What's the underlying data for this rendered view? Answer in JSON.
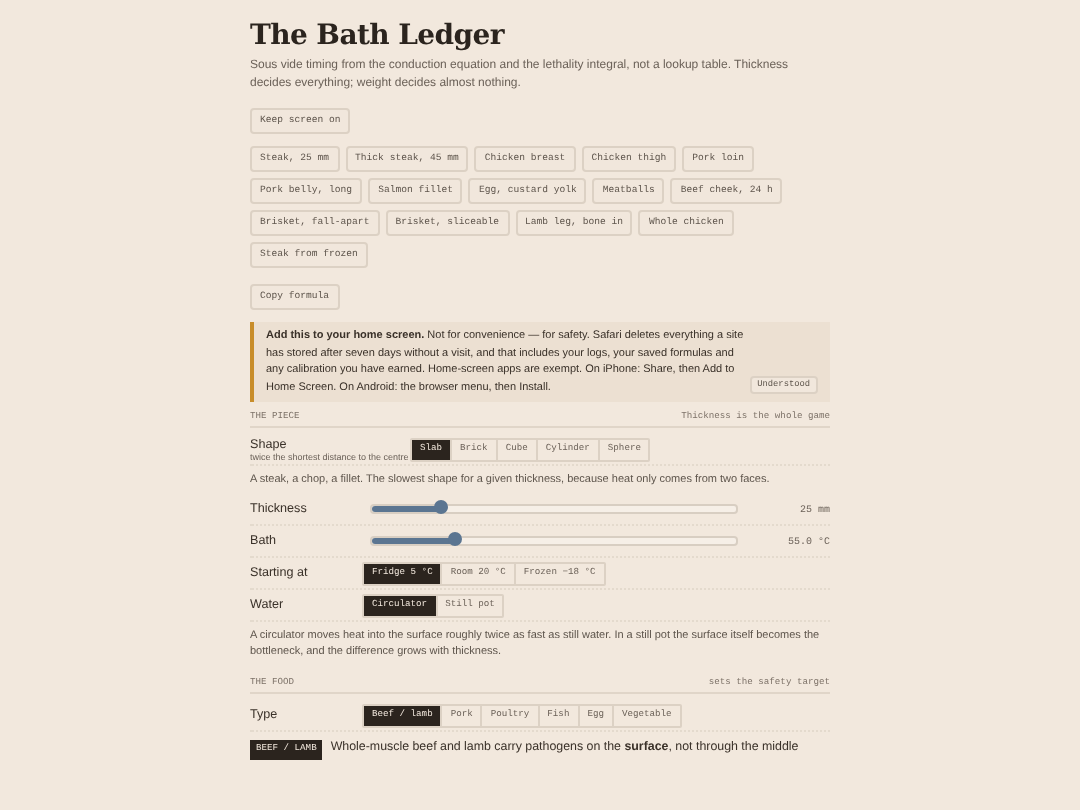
{
  "title": "The Bath Ledger",
  "subtitle": "Sous vide timing from the conduction equation and the lethality integral, not a lookup table. Thickness decides everything; weight decides almost nothing.",
  "keep_screen_button": "Keep screen on",
  "presets": [
    "Steak, 25 mm",
    "Thick steak, 45 mm",
    "Chicken breast",
    "Chicken thigh",
    "Pork loin",
    "Pork belly, long",
    "Salmon fillet",
    "Egg, custard yolk",
    "Meatballs",
    "Beef cheek, 24 h",
    "Brisket, fall-apart",
    "Brisket, sliceable",
    "Lamb leg, bone in",
    "Whole chicken",
    "Steak from frozen"
  ],
  "copy_button": "Copy formula",
  "notice": {
    "text": "**Add this to your home screen.** Not for convenience — for safety. Safari deletes everything a site has stored after seven days without a visit, and that includes your logs, your saved formulas and any calibration you have earned. Home-screen apps are exempt. On iPhone: Share, then Add to Home Screen. On Android: the browser menu, then Install.",
    "button": "Understood"
  },
  "sections": [
    {
      "heading": "THE PIECE",
      "note": "Thickness is the whole game",
      "rows": [
        {
          "kind": "segmented",
          "label": "Shape",
          "hint": "twice the shortest distance to the centre",
          "options": [
            {
              "label": "Slab",
              "selected": true
            },
            {
              "label": "Brick",
              "selected": false
            },
            {
              "label": "Cube",
              "selected": false
            },
            {
              "label": "Cylinder",
              "selected": false
            },
            {
              "label": "Sphere",
              "selected": false
            }
          ]
        },
        {
          "kind": "text",
          "text": "A steak, a chop, a fillet. The slowest shape for a given thickness, because heat only comes from two faces."
        },
        {
          "kind": "slider",
          "label": "Thickness",
          "level": 0.19,
          "reading": "25 mm"
        },
        {
          "kind": "slider",
          "label": "Bath",
          "level": 0.23,
          "reading": "55.0 °C"
        },
        {
          "kind": "segmented",
          "label": "Starting at",
          "options": [
            {
              "label": "Fridge 5 °C",
              "selected": true
            },
            {
              "label": "Room 20 °C",
              "selected": false
            },
            {
              "label": "Frozen −18 °C",
              "selected": false
            }
          ]
        },
        {
          "kind": "segmented",
          "label": "Water",
          "options": [
            {
              "label": "Circulator",
              "selected": true
            },
            {
              "label": "Still pot",
              "selected": false
            }
          ]
        },
        {
          "kind": "text",
          "text": "A circulator moves heat into the surface roughly twice as fast as still water. In a still pot the surface itself becomes the bottleneck, and the difference grows with thickness."
        }
      ]
    },
    {
      "heading": "THE FOOD",
      "note": "sets the safety target",
      "rows": [
        {
          "kind": "segmented",
          "label": "Type",
          "options": [
            {
              "label": "Beef / lamb",
              "selected": true
            },
            {
              "label": "Pork",
              "selected": false
            },
            {
              "label": "Poultry",
              "selected": false
            },
            {
              "label": "Fish",
              "selected": false
            },
            {
              "label": "Egg",
              "selected": false
            },
            {
              "label": "Vegetable",
              "selected": false
            }
          ]
        },
        {
          "kind": "tagged",
          "tag": "BEEF / LAMB",
          "text": "Whole-muscle beef and lamb carry pathogens on the **surface**, not through the middle"
        }
      ]
    }
  ]
}
